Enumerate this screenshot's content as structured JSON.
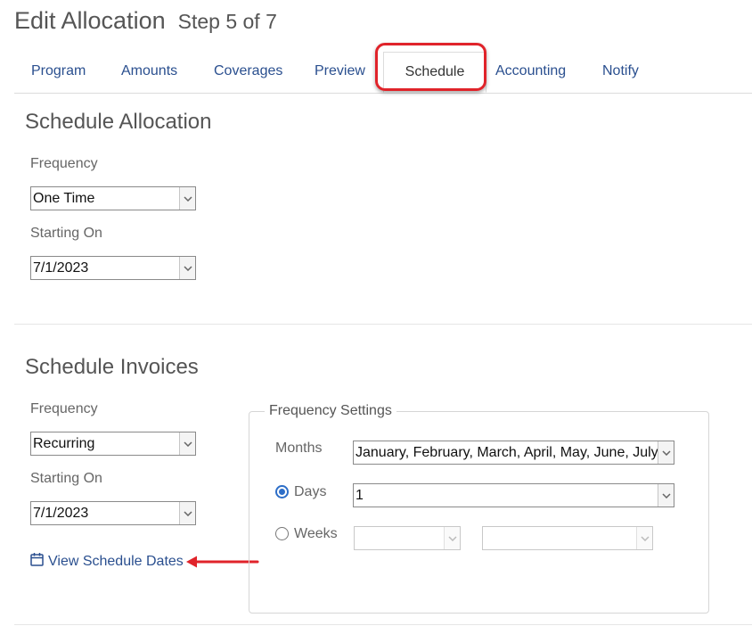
{
  "header": {
    "title": "Edit Allocation",
    "step": "Step 5 of 7"
  },
  "tabs": [
    {
      "label": "Program"
    },
    {
      "label": "Amounts"
    },
    {
      "label": "Coverages"
    },
    {
      "label": "Preview"
    },
    {
      "label": "Schedule",
      "active": true
    },
    {
      "label": "Accounting"
    },
    {
      "label": "Notify"
    }
  ],
  "schedule_allocation": {
    "title": "Schedule Allocation",
    "frequency_label": "Frequency",
    "frequency_value": "One Time",
    "starting_label": "Starting On",
    "starting_value": "7/1/2023"
  },
  "schedule_invoices": {
    "title": "Schedule Invoices",
    "frequency_label": "Frequency",
    "frequency_value": "Recurring",
    "starting_label": "Starting On",
    "starting_value": "7/1/2023",
    "view_dates_link": "View Schedule Dates"
  },
  "frequency_settings": {
    "legend": "Frequency Settings",
    "months_label": "Months",
    "months_value": "January, February, March, April, May, June, July, August, September, October, November, December",
    "days_label": "Days",
    "days_value": "1",
    "days_selected": true,
    "weeks_label": "Weeks",
    "weeks_selected": false,
    "weeks_value_1": "",
    "weeks_value_2": ""
  },
  "colors": {
    "link": "#2a4f8f",
    "highlight": "#e0232a",
    "radio": "#2d6ec8"
  }
}
